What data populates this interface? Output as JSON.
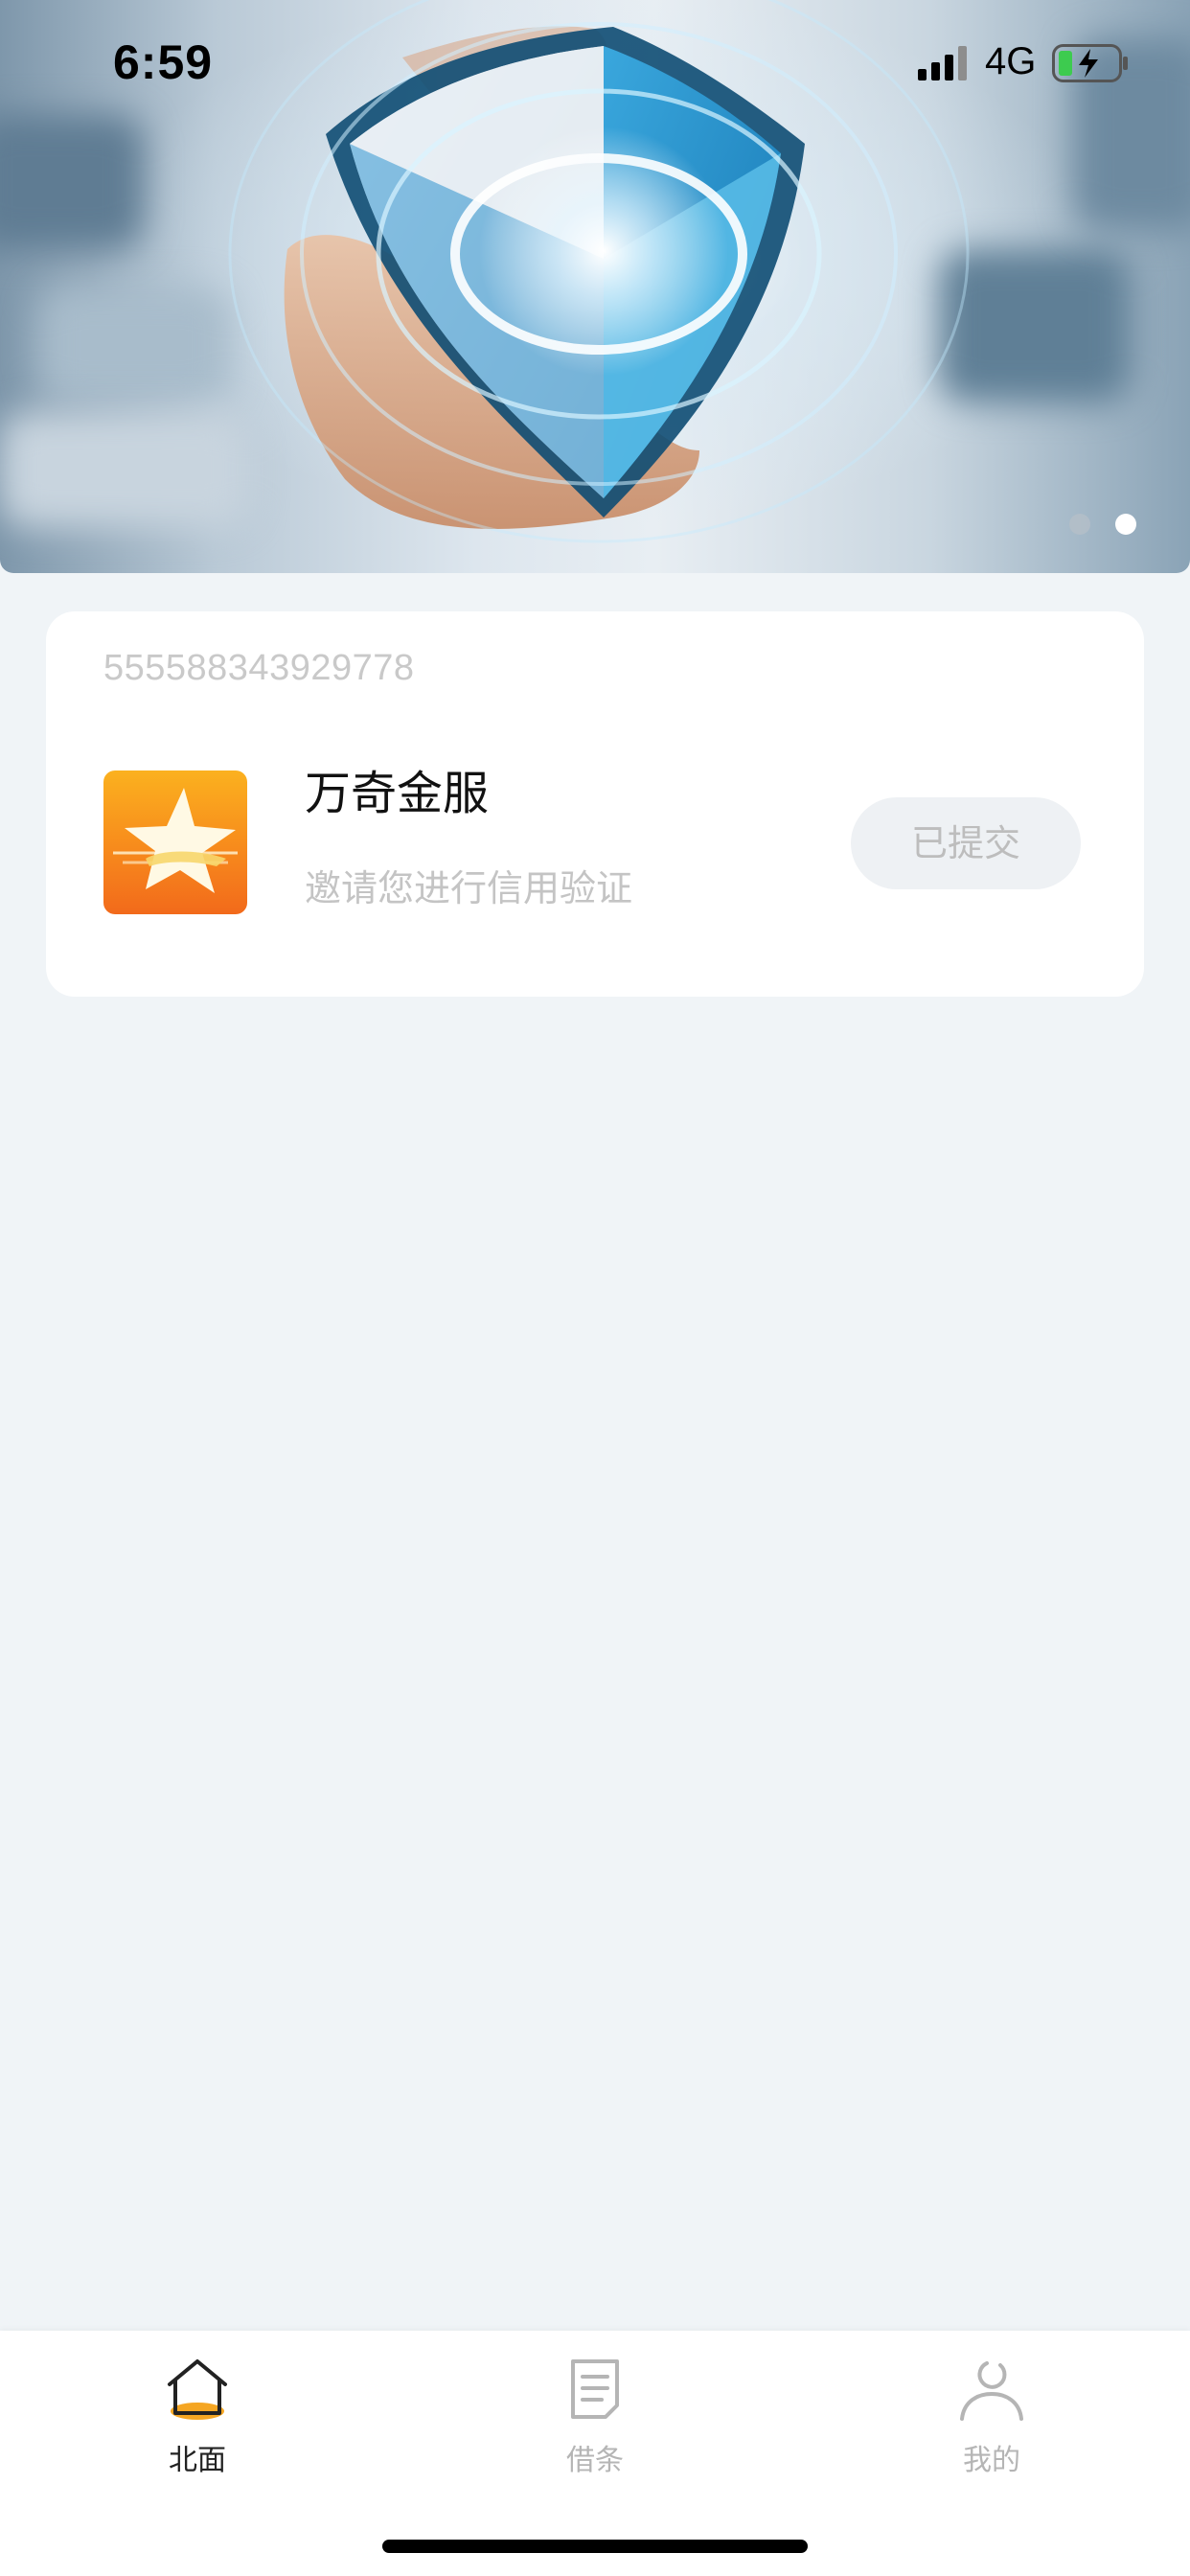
{
  "status_bar": {
    "time": "6:59",
    "network": "4G",
    "signal_icon": "signal-bars-icon",
    "battery_icon": "battery-charging-icon"
  },
  "banner": {
    "image": "security-shield-banner",
    "dots": [
      {
        "active": false
      },
      {
        "active": true
      }
    ]
  },
  "card": {
    "number": "555588343929778",
    "app_name": "万奇金服",
    "description": "邀请您进行信用验证",
    "button_label": "已提交",
    "logo_icon": "star-app-logo-icon"
  },
  "tab_bar": {
    "tabs": [
      {
        "label": "北面",
        "icon": "home-icon",
        "active": true
      },
      {
        "label": "借条",
        "icon": "document-icon",
        "active": false
      },
      {
        "label": "我的",
        "icon": "profile-icon",
        "active": false
      }
    ]
  },
  "colors": {
    "background": "#f0f4f7",
    "card": "#ffffff",
    "accent_orange": "#f5a623",
    "muted_text": "#c4c4c4",
    "active_tab_text": "#222222"
  }
}
